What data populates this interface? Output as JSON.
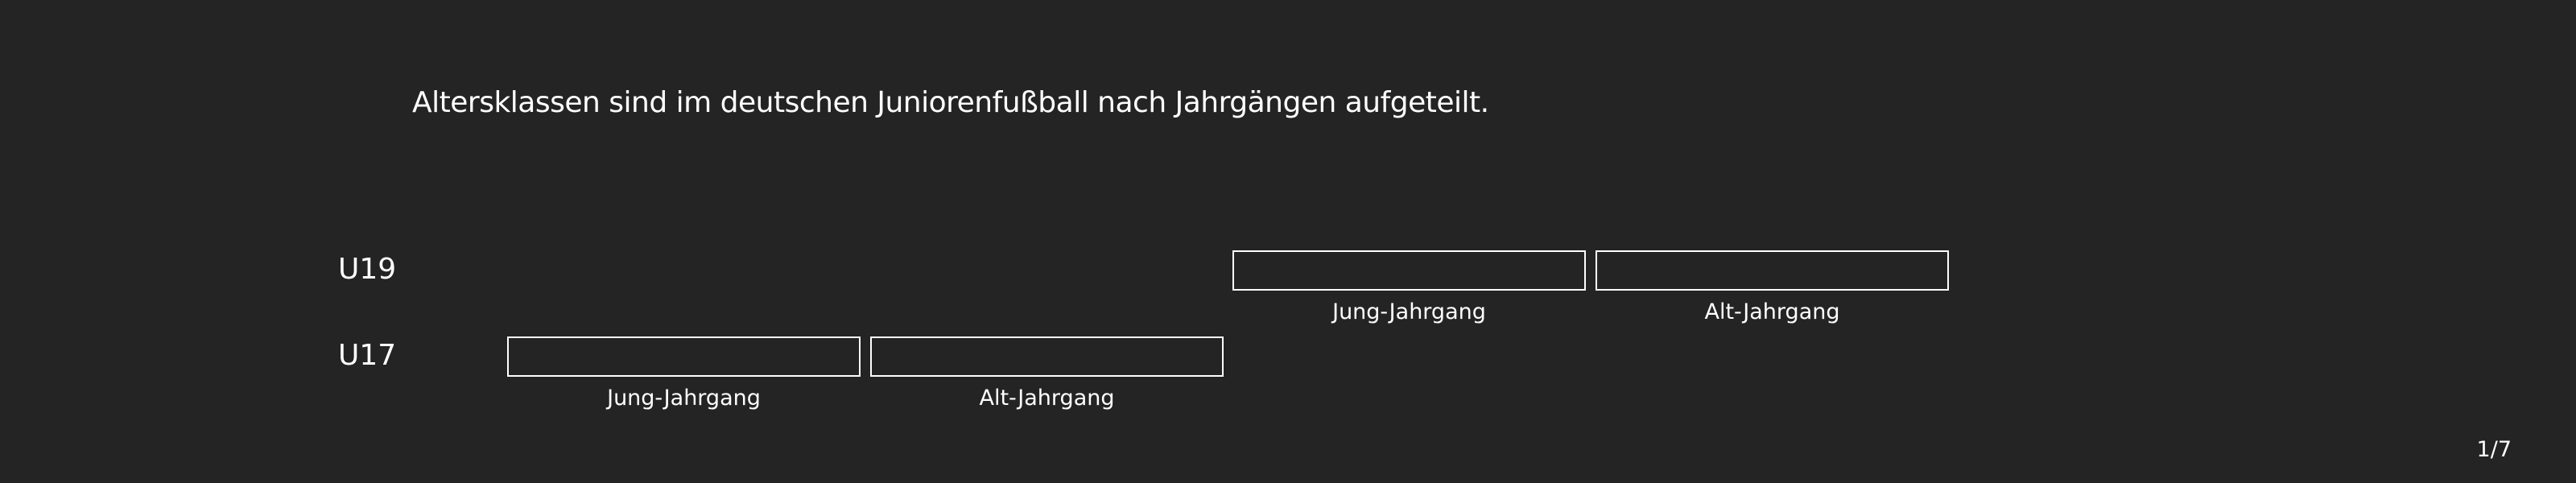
{
  "headline": "Altersklassen sind im deutschen Juniorenfußball nach Jahrgängen aufgeteilt.",
  "rows": [
    {
      "label": "U19",
      "segments": [
        {
          "label": "Jung-Jahrgang"
        },
        {
          "label": "Alt-Jahrgang"
        }
      ]
    },
    {
      "label": "U17",
      "segments": [
        {
          "label": "Jung-Jahrgang"
        },
        {
          "label": "Alt-Jahrgang"
        }
      ]
    }
  ],
  "pagination": "1/7",
  "colors": {
    "background": "#242424",
    "foreground": "#ffffff"
  }
}
